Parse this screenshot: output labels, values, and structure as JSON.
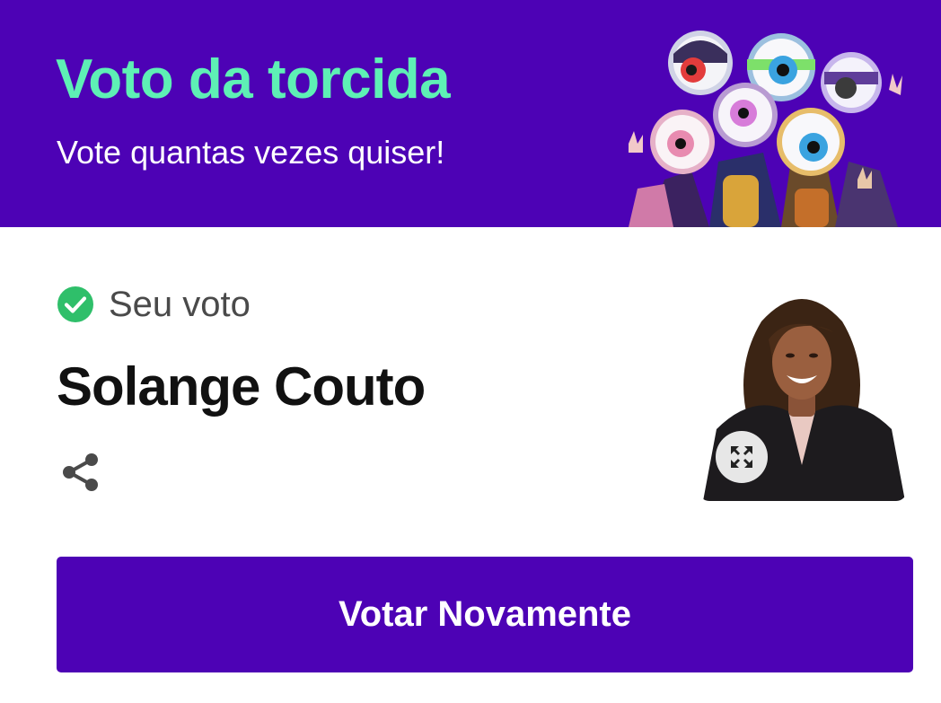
{
  "header": {
    "title": "Voto da torcida",
    "subtitle": "Vote quantas vezes quiser!",
    "background_color": "#4d02b5",
    "title_color": "#5ef0b5",
    "illustration": "bbb-eye-mascots"
  },
  "vote": {
    "status_icon": "check-circle-icon",
    "status_color": "#2fbf6a",
    "status_label": "Seu voto",
    "candidate_name": "Solange Couto",
    "share_icon": "share-icon",
    "photo_description_icon": "candidate-photo",
    "expand_icon": "expand-icon"
  },
  "actions": {
    "vote_again_label": "Votar Novamente",
    "button_color": "#4d02b5"
  }
}
